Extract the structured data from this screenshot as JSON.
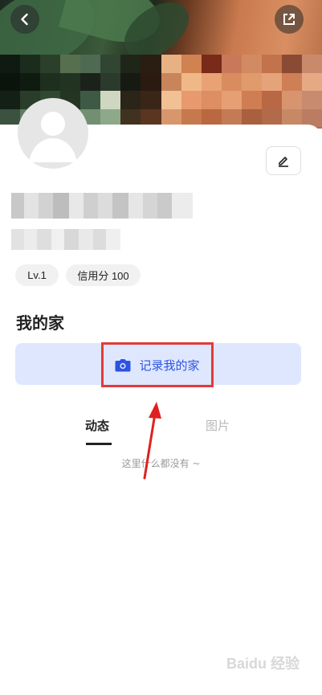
{
  "profile": {
    "level_chip": "Lv.1",
    "credit_chip": "信用分 100"
  },
  "home": {
    "section_title": "我的家",
    "record_label": "记录我的家"
  },
  "tabs": [
    {
      "label": "动态",
      "active": true
    },
    {
      "label": "图片",
      "active": false
    }
  ],
  "feed": {
    "empty_text": "这里什么都没有 ~"
  },
  "watermark": {
    "text": "Baidu 经验"
  },
  "colors": {
    "accent": "#2d54e0",
    "record_bg": "#dfe7ff",
    "highlight": "#e23a3a"
  },
  "icons": [
    "back-icon",
    "share-icon",
    "edit-icon",
    "camera-icon"
  ]
}
